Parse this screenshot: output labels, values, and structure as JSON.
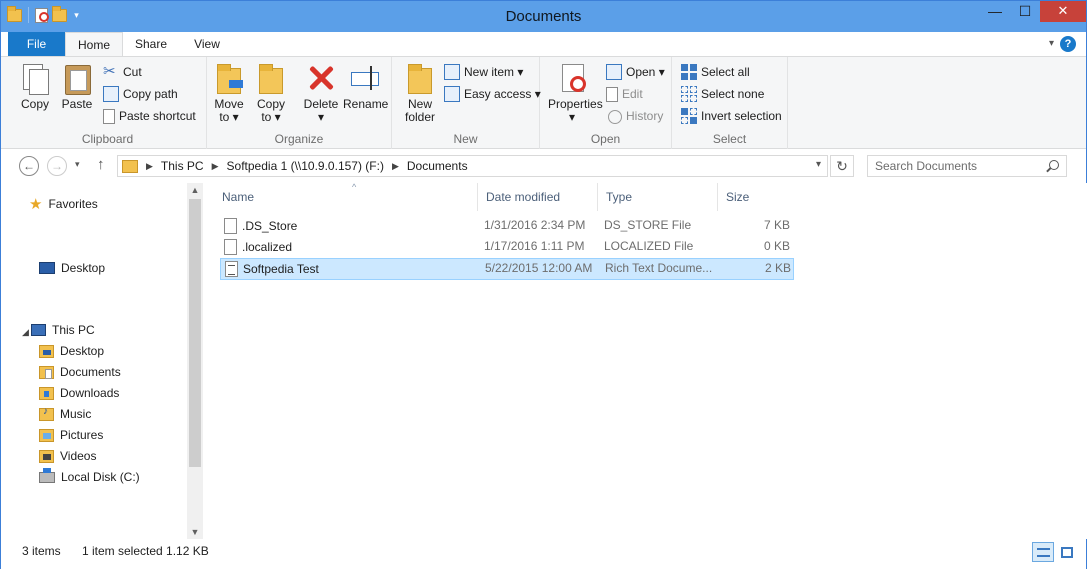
{
  "window": {
    "title": "Documents",
    "controls": {
      "minimize": "—",
      "maximize": "☐",
      "close": "✕"
    }
  },
  "tabs": {
    "file": "File",
    "home": "Home",
    "share": "Share",
    "view": "View",
    "help": "?"
  },
  "ribbon": {
    "clipboard": {
      "label": "Clipboard",
      "copy": "Copy",
      "paste": "Paste",
      "cut": "Cut",
      "copy_path": "Copy path",
      "paste_shortcut": "Paste shortcut"
    },
    "organize": {
      "label": "Organize",
      "move_to_1": "Move",
      "move_to_2": "to ▾",
      "copy_to_1": "Copy",
      "copy_to_2": "to ▾",
      "delete": "Delete",
      "delete_dd": "▾",
      "rename": "Rename"
    },
    "new": {
      "label": "New",
      "new_folder_1": "New",
      "new_folder_2": "folder",
      "new_item": "New item ▾",
      "easy_access": "Easy access ▾"
    },
    "open": {
      "label": "Open",
      "properties": "Properties",
      "properties_dd": "▾",
      "open": "Open ▾",
      "edit": "Edit",
      "history": "History"
    },
    "select": {
      "label": "Select",
      "select_all": "Select all",
      "select_none": "Select none",
      "invert_selection": "Invert selection"
    }
  },
  "address": {
    "crumbs": [
      "This PC",
      "Softpedia 1 (\\\\10.9.0.157) (F:)",
      "Documents"
    ],
    "search_placeholder": "Search Documents"
  },
  "navpane": {
    "favorites": "Favorites",
    "desktop_root": "Desktop",
    "this_pc": "This PC",
    "items": [
      "Desktop",
      "Documents",
      "Downloads",
      "Music",
      "Pictures",
      "Videos",
      "Local Disk (C:)"
    ]
  },
  "columns": {
    "name": "Name",
    "date": "Date modified",
    "type": "Type",
    "size": "Size"
  },
  "files": [
    {
      "name": ".DS_Store",
      "date": "1/31/2016 2:34 PM",
      "type": "DS_STORE File",
      "size": "7 KB"
    },
    {
      "name": ".localized",
      "date": "1/17/2016 1:11 PM",
      "type": "LOCALIZED File",
      "size": "0 KB"
    },
    {
      "name": "Softpedia Test",
      "date": "5/22/2015 12:00 AM",
      "type": "Rich Text Docume...",
      "size": "2 KB"
    }
  ],
  "status": {
    "items": "3 items",
    "selected": "1 item selected  1.12 KB"
  }
}
